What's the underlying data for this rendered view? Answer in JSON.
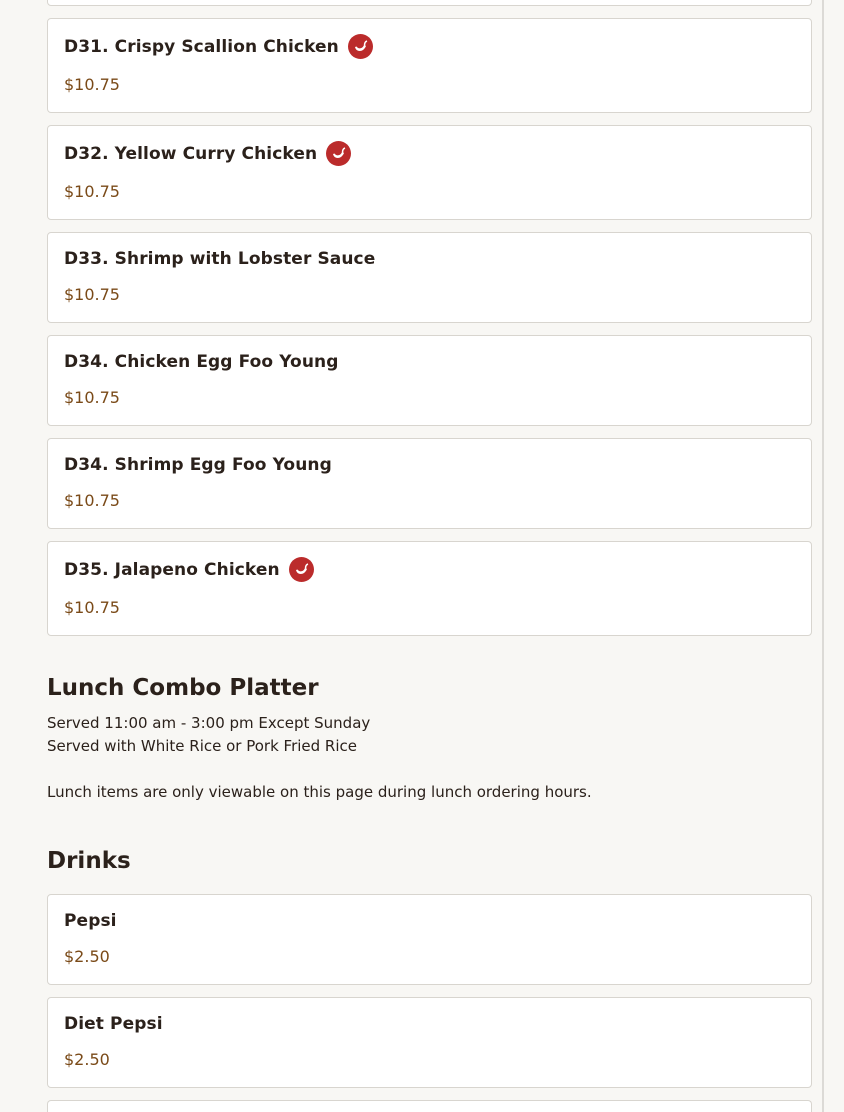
{
  "dinner_items": [
    {
      "name": "D31. Crispy Scallion Chicken",
      "price": "$10.75",
      "spicy_icon": "chili-pepper-icon"
    },
    {
      "name": "D32. Yellow Curry Chicken",
      "price": "$10.75",
      "spicy_icon": "chili-pepper-icon"
    },
    {
      "name": "D33. Shrimp with Lobster Sauce",
      "price": "$10.75"
    },
    {
      "name": "D34. Chicken Egg Foo Young",
      "price": "$10.75"
    },
    {
      "name": "D34. Shrimp Egg Foo Young",
      "price": "$10.75"
    },
    {
      "name": "D35. Jalapeno Chicken",
      "price": "$10.75",
      "spicy_icon": "chili-pepper-icon"
    }
  ],
  "lunch": {
    "title": "Lunch Combo Platter",
    "line1": "Served 11:00 am - 3:00 pm Except Sunday",
    "line2": "Served with White Rice or Pork Fried Rice",
    "notice": "Lunch items are only viewable on this page during lunch ordering hours."
  },
  "drinks": {
    "title": "Drinks",
    "items": [
      {
        "name": "Pepsi",
        "price": "$2.50"
      },
      {
        "name": "Diet Pepsi",
        "price": "$2.50"
      }
    ]
  },
  "colors": {
    "page_background": "#f8f7f4",
    "price_color": "#7a4a18",
    "spicy_badge": "#bb2b2b"
  }
}
